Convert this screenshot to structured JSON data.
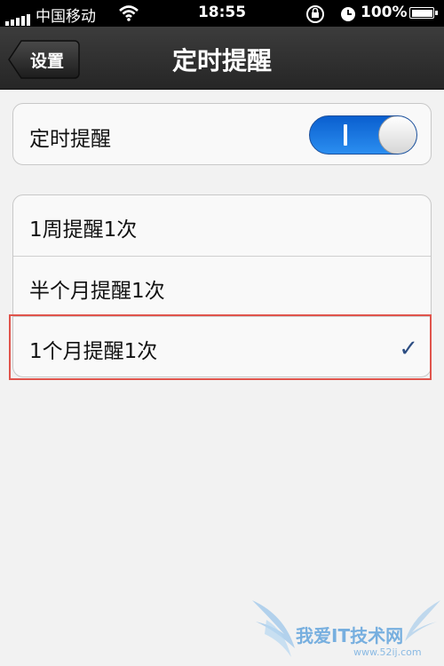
{
  "status_bar": {
    "carrier": "中国移动",
    "time": "18:55",
    "battery": "100%",
    "icons": [
      "signal-icon",
      "wifi-icon",
      "rotation-lock-icon",
      "alarm-clock-icon",
      "battery-icon"
    ]
  },
  "nav": {
    "back_label": "设置",
    "title": "定时提醒"
  },
  "toggle_section": {
    "label": "定时提醒",
    "switch_on": true
  },
  "options": [
    {
      "label": "1周提醒1次",
      "selected": false
    },
    {
      "label": "半个月提醒1次",
      "selected": false
    },
    {
      "label": "1个月提醒1次",
      "selected": true
    }
  ],
  "checkmark": "✓",
  "watermark": {
    "text": "我爱IT技术网",
    "url": "www.52ij.com"
  },
  "colors": {
    "toggle_on": "#1f7ae6",
    "checkmark": "#2d4e83",
    "highlight_border": "#e0544c",
    "navbar": "#2f2f2f"
  }
}
